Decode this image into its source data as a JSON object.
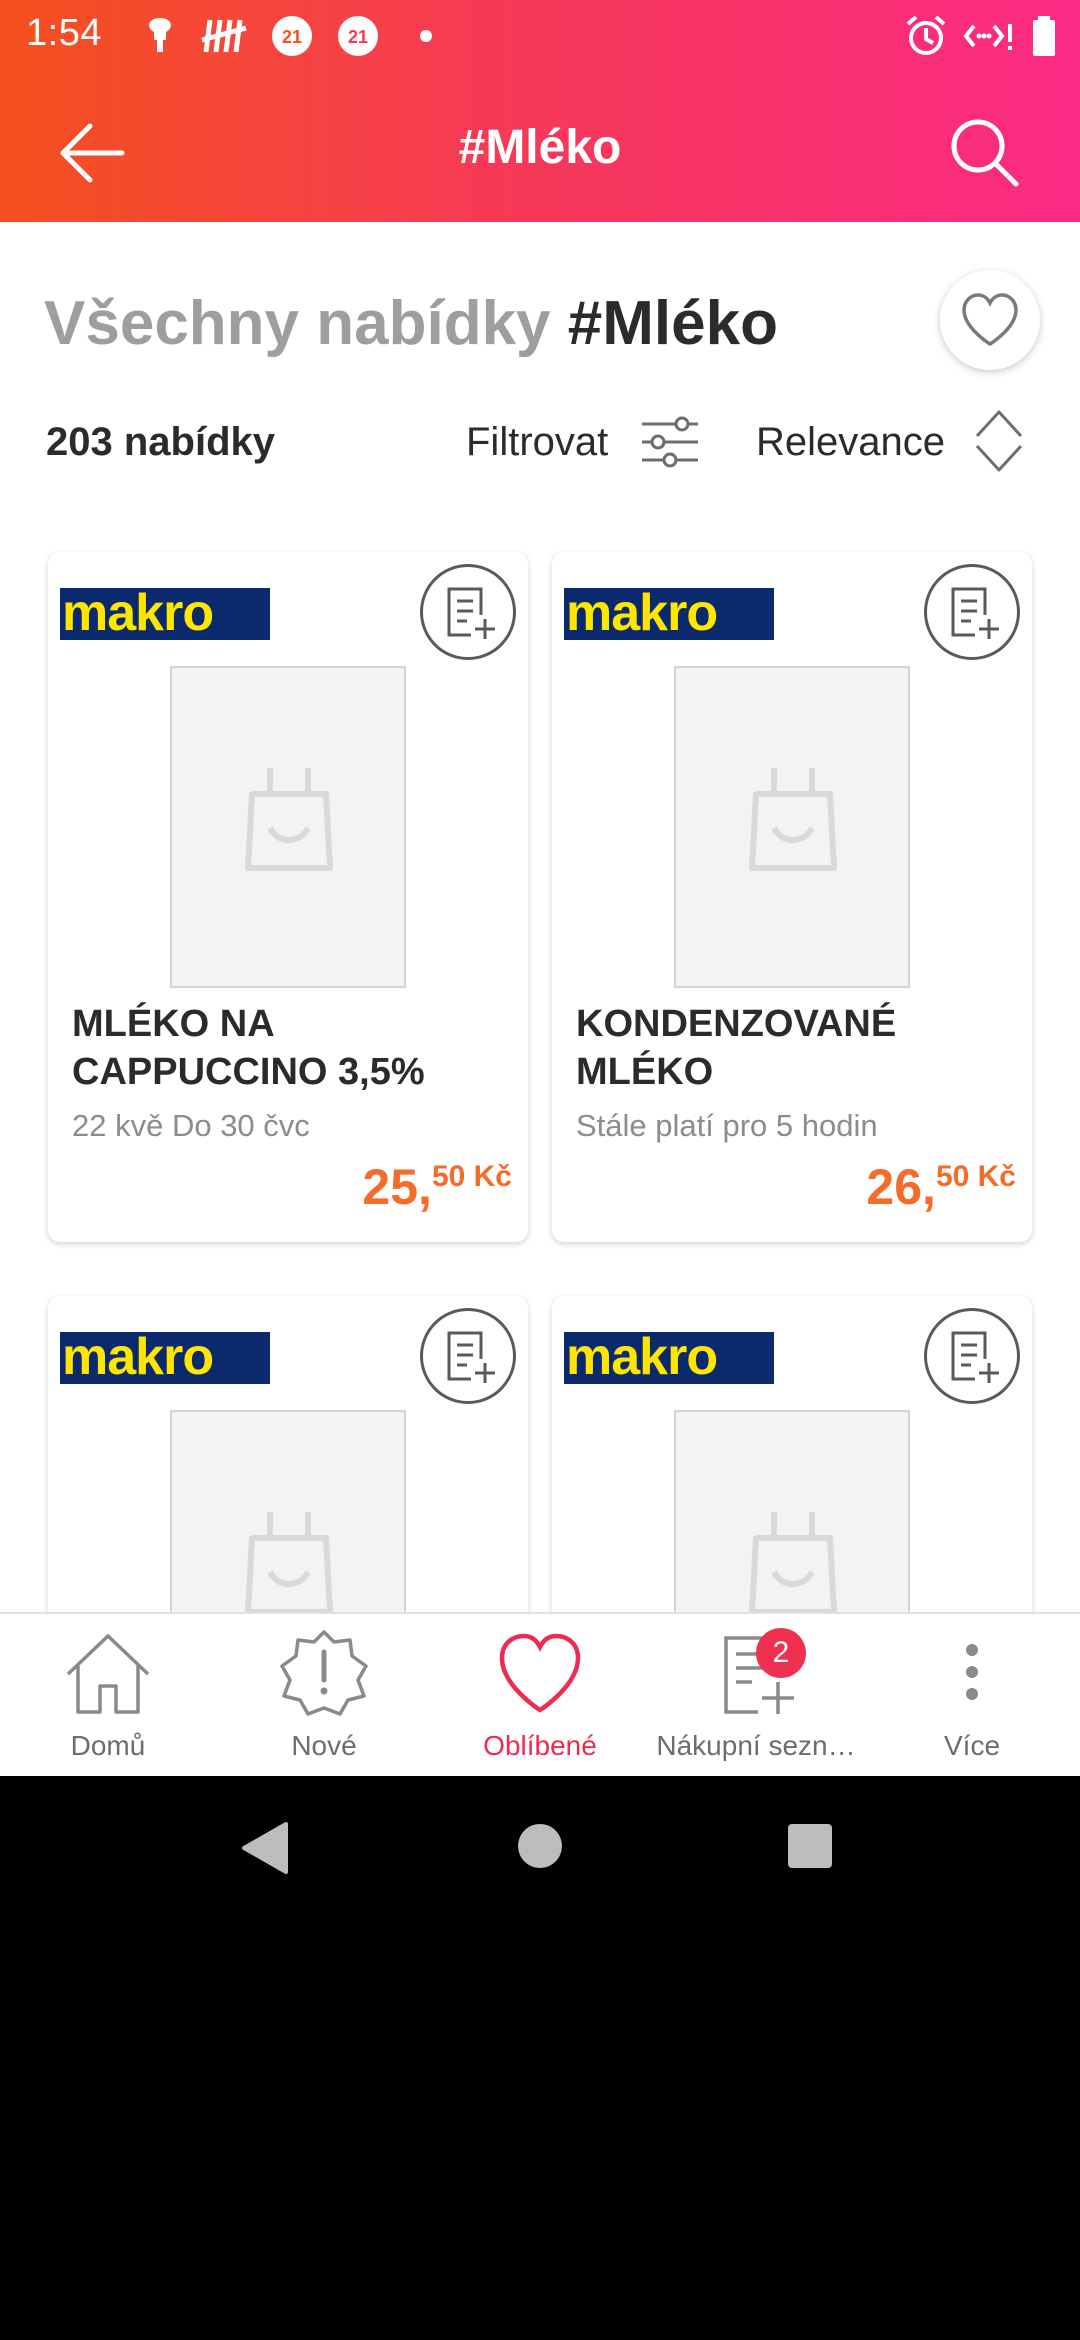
{
  "status_bar": {
    "time": "1:54"
  },
  "app_bar": {
    "title": "#Mléko"
  },
  "heading": {
    "prefix": "Všechny nabídky ",
    "tag": "#Mléko"
  },
  "toolbar": {
    "count": "203 nabídky",
    "filter_label": "Filtrovat",
    "sort_label": "Relevance"
  },
  "offers": [
    {
      "retailer": "makro",
      "title": "MLÉKO NA CAPPUCCINO 3,5%",
      "validity": "22 kvě Do 30 čvc",
      "price_main": "25,",
      "price_cents": "50 Kč"
    },
    {
      "retailer": "makro",
      "title": "KONDENZOVANÉ MLÉKO",
      "validity": "Stále platí pro 5 hodin",
      "price_main": "26,",
      "price_cents": "50 Kč"
    },
    {
      "retailer": "makro"
    },
    {
      "retailer": "makro"
    }
  ],
  "bottom_nav": [
    {
      "label": "Domů",
      "icon": "home-icon"
    },
    {
      "label": "Nové",
      "icon": "new-badge-icon"
    },
    {
      "label": "Oblíbené",
      "icon": "heart-icon",
      "active": true
    },
    {
      "label": "Nákupní sezn…",
      "icon": "shopping-list-icon",
      "badge": "2"
    },
    {
      "label": "Více",
      "icon": "more-vert-icon"
    }
  ],
  "colors": {
    "gradient_start": "#f4511e",
    "gradient_end": "#fb2a85",
    "price": "#f56b2a",
    "active": "#ee2b52",
    "makro_bg": "#0b2a6e",
    "makro_text": "#ffe600"
  }
}
